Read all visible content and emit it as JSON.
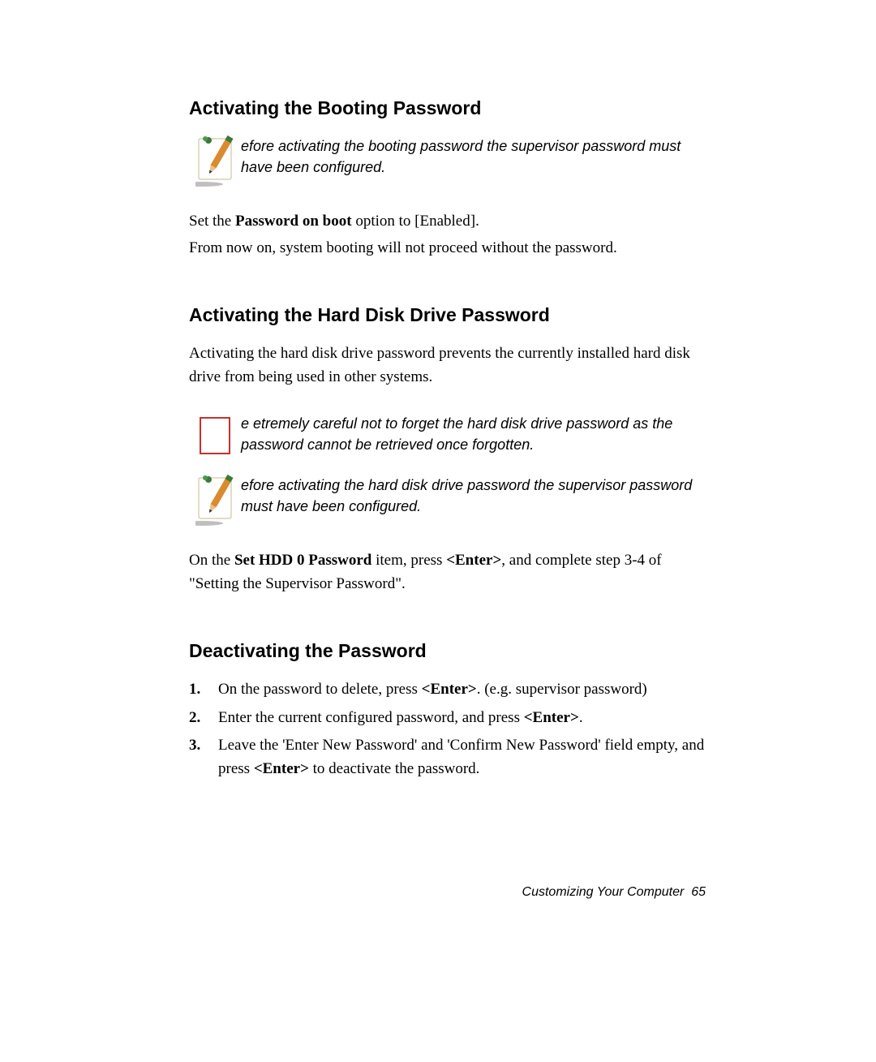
{
  "section1": {
    "heading": "Activating the Booting Password",
    "note": "efore activating the booting password the supervisor password must have been configured.",
    "body_prefix": "Set the ",
    "body_bold": "Password on boot",
    "body_suffix": " option to [Enabled].",
    "body_line2": "From now on, system booting will not proceed without the password."
  },
  "section2": {
    "heading": "Activating the Hard Disk Drive Password",
    "intro": "Activating the hard disk drive password prevents the currently installed hard disk drive from being used in other systems.",
    "note1": "e etremely careful not to forget the hard disk drive password as the password cannot be retrieved once forgotten.",
    "note2": "efore activating the hard disk drive password the supervisor password must have been configured.",
    "body_prefix": "On the ",
    "body_bold1": "Set HDD 0 Password",
    "body_mid": " item, press ",
    "body_bold2": "<Enter>",
    "body_suffix": ", and complete step 3-4 of \"Setting the Supervisor Password\"."
  },
  "section3": {
    "heading": "Deactivating the Password",
    "steps": [
      {
        "n": "1.",
        "pre": "On the password to delete, press ",
        "b": "<Enter>",
        "post": ". (e.g. supervisor password)"
      },
      {
        "n": "2.",
        "pre": "Enter the current configured password, and press ",
        "b": "<Enter>",
        "post": "."
      },
      {
        "n": "3.",
        "pre": "Leave the 'Enter New Password' and 'Confirm New Password' field empty, and press ",
        "b": "<Enter>",
        "post": " to deactivate the password."
      }
    ]
  },
  "footer": {
    "title": "Customizing Your Computer",
    "page": "65"
  }
}
